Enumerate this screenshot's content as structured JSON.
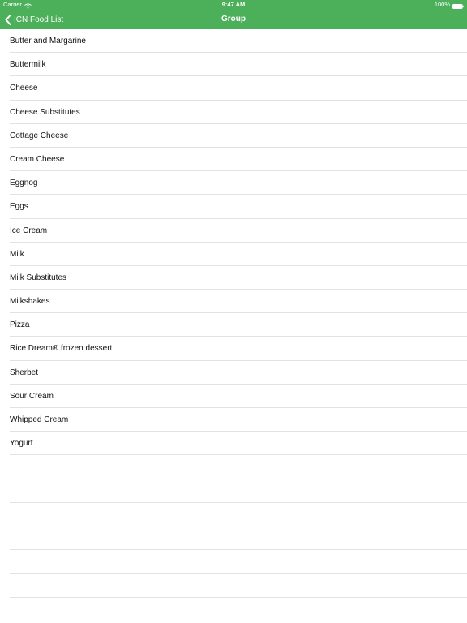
{
  "status_bar": {
    "carrier": "Carrier",
    "time": "9:47 AM",
    "battery": "100%"
  },
  "nav": {
    "back_label": "ICN Food List",
    "title": "Group"
  },
  "colors": {
    "header_green": "#4caf5a",
    "separator": "#e2e2e2"
  },
  "items": [
    {
      "label": "Butter and Margarine"
    },
    {
      "label": "Buttermilk"
    },
    {
      "label": "Cheese"
    },
    {
      "label": "Cheese Substitutes"
    },
    {
      "label": "Cottage Cheese"
    },
    {
      "label": "Cream Cheese"
    },
    {
      "label": "Eggnog"
    },
    {
      "label": "Eggs"
    },
    {
      "label": "Ice Cream"
    },
    {
      "label": "Milk"
    },
    {
      "label": "Milk Substitutes"
    },
    {
      "label": "Milkshakes"
    },
    {
      "label": "Pizza"
    },
    {
      "label": "Rice Dream® frozen dessert"
    },
    {
      "label": "Sherbet"
    },
    {
      "label": "Sour Cream"
    },
    {
      "label": "Whipped Cream"
    },
    {
      "label": "Yogurt"
    }
  ]
}
